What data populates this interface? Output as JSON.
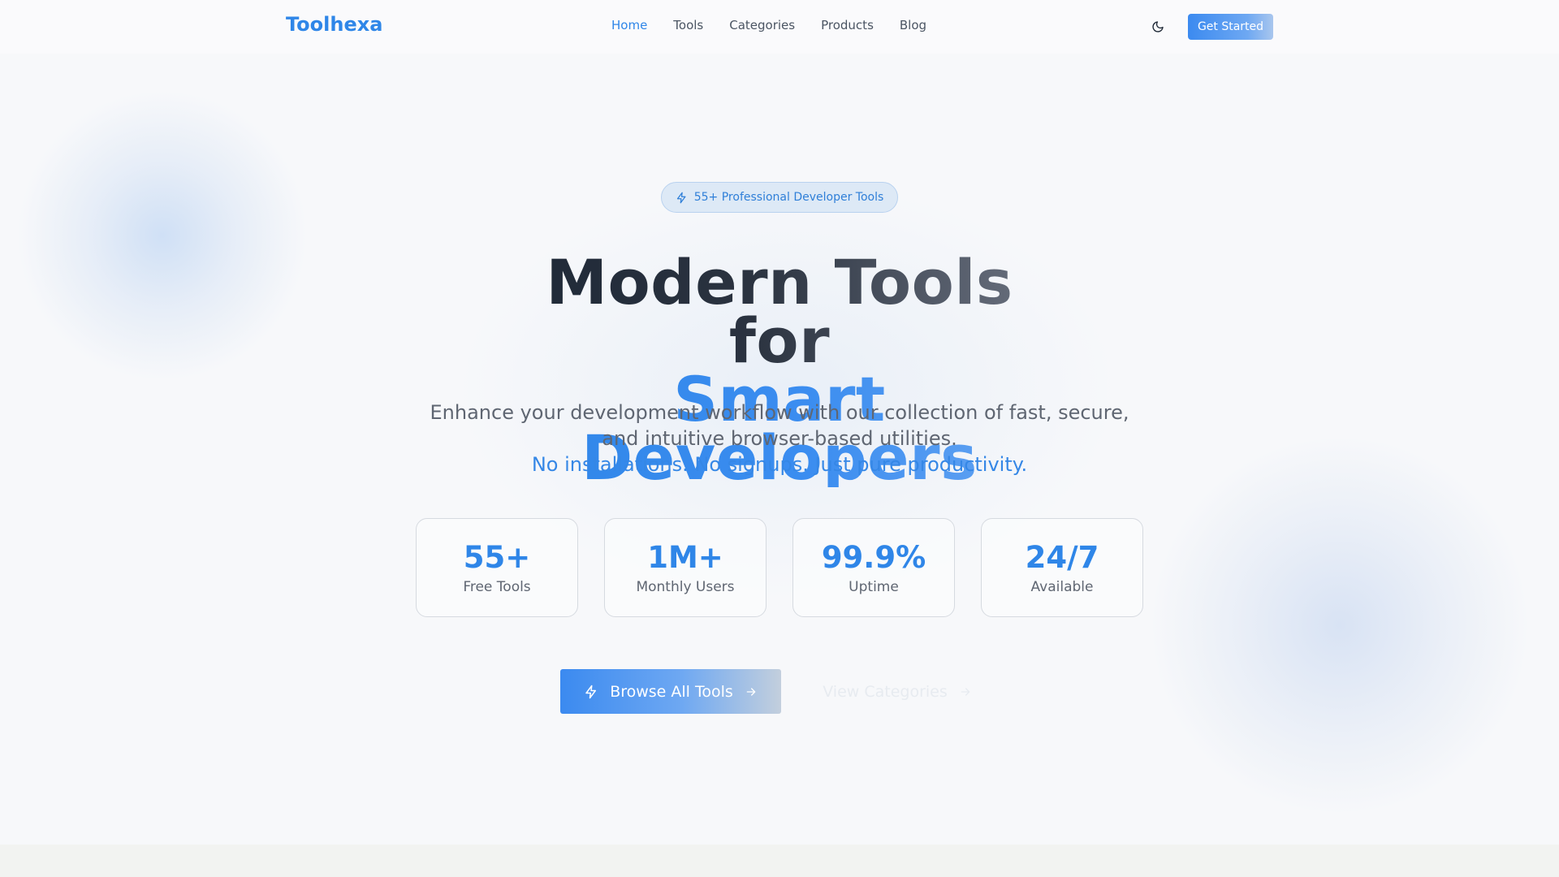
{
  "header": {
    "logo": "Toolhexa",
    "nav": [
      {
        "label": "Home",
        "active": true
      },
      {
        "label": "Tools",
        "active": false
      },
      {
        "label": "Categories",
        "active": false
      },
      {
        "label": "Products",
        "active": false
      },
      {
        "label": "Blog",
        "active": false
      }
    ],
    "theme_toggle_icon": "moon-icon",
    "cta_label": "Get Started"
  },
  "badge": {
    "icon": "lightning-icon",
    "text": "55+ Professional Developer Tools"
  },
  "hero": {
    "title_line1": "Modern Tools for",
    "title_line2": "Smart Developers",
    "subtitle_line1": "Enhance your development workflow with our collection of fast, secure,",
    "subtitle_line2": "and intuitive browser-based utilities.",
    "subtitle_accent": "No installations. No signups. Just pure productivity."
  },
  "stats": [
    {
      "value": "55+",
      "label": "Free Tools"
    },
    {
      "value": "1M+",
      "label": "Monthly Users"
    },
    {
      "value": "99.9%",
      "label": "Uptime"
    },
    {
      "value": "24/7",
      "label": "Available"
    }
  ],
  "actions": {
    "primary_label": "Browse All Tools",
    "primary_icon": "lightning-icon",
    "secondary_label": "View Categories",
    "arrow_icon": "arrow-right-icon"
  },
  "colors": {
    "accent": "#2f86e8",
    "text_dark": "#1f2937",
    "text_muted": "#5f6672",
    "background": "#f7f8fa"
  }
}
